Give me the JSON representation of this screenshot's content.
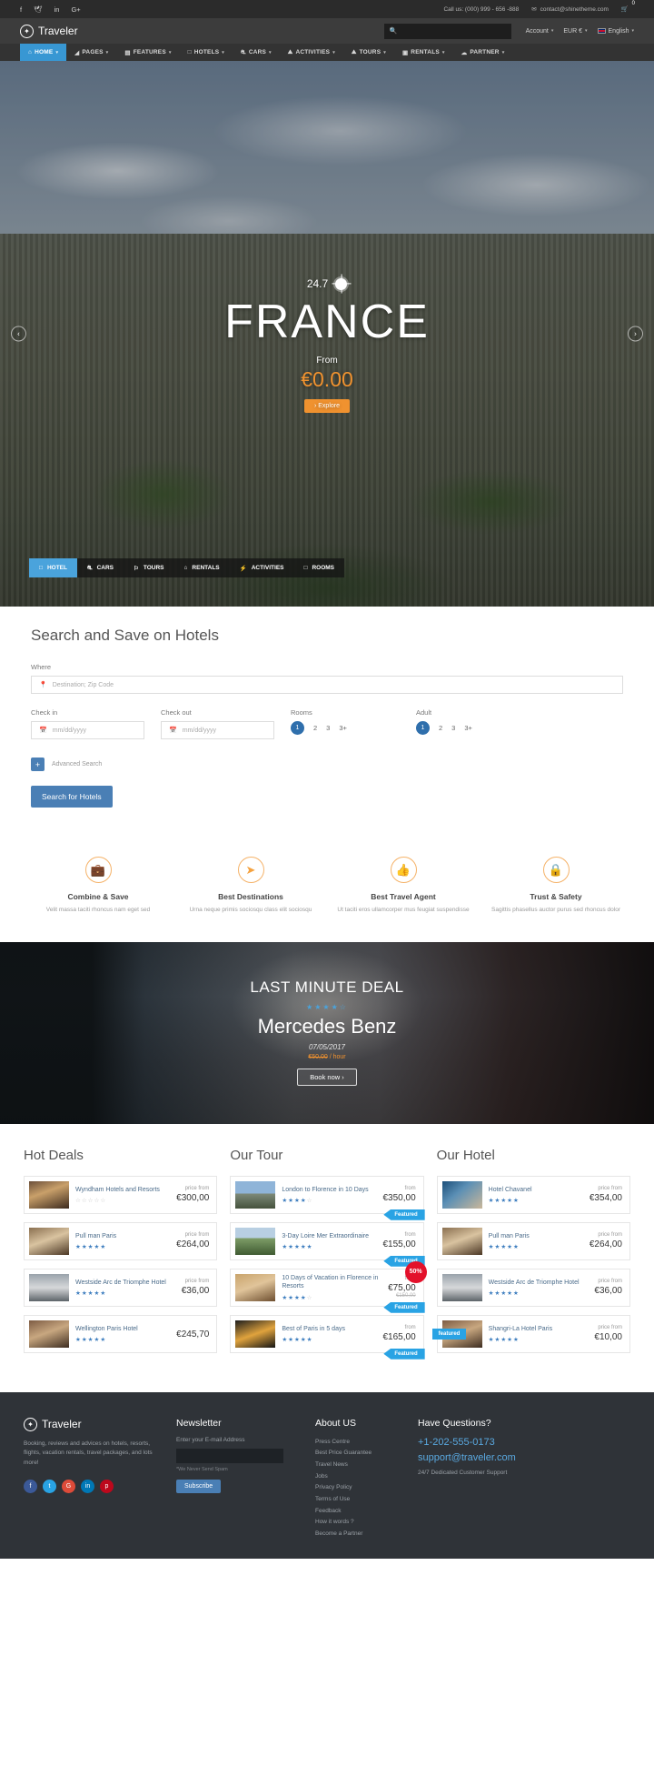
{
  "topbar": {
    "social": [
      {
        "name": "facebook-icon",
        "glyph": "f"
      },
      {
        "name": "twitter-icon",
        "glyph": "🕊"
      },
      {
        "name": "linkedin-icon",
        "glyph": "in"
      },
      {
        "name": "googleplus-icon",
        "glyph": "G+"
      }
    ],
    "phone": "Call us: (000) 999 - 656 -888",
    "email": "contact@shinetheme.com",
    "cart_count": "0"
  },
  "header": {
    "brand": "Traveler",
    "search_placeholder": "",
    "account_label": "Account",
    "currency_label": "EUR €",
    "language_label": "English"
  },
  "nav": {
    "items": [
      {
        "label": "HOME",
        "icon": "home-icon",
        "caret": true,
        "active": true
      },
      {
        "label": "PAGES",
        "icon": "pages-icon",
        "caret": true,
        "active": false
      },
      {
        "label": "FEATURES",
        "icon": "features-icon",
        "caret": true,
        "active": false
      },
      {
        "label": "HOTELS",
        "icon": "hotel-icon",
        "caret": true,
        "active": false
      },
      {
        "label": "CARS",
        "icon": "car-icon",
        "caret": true,
        "active": false
      },
      {
        "label": "ACTIVITIES",
        "icon": "activities-icon",
        "caret": true,
        "active": false
      },
      {
        "label": "TOURS",
        "icon": "tour-icon",
        "caret": true,
        "active": false
      },
      {
        "label": "RENTALS",
        "icon": "rental-icon",
        "caret": true,
        "active": false
      },
      {
        "label": "PARTNER",
        "icon": "partner-icon",
        "caret": true,
        "active": false
      }
    ]
  },
  "hero": {
    "temperature": "24.7",
    "title": "FRANCE",
    "from_label": "From",
    "price": "€0.00",
    "cta": "› Explore",
    "prev": "‹",
    "next": "›"
  },
  "search_tabs": [
    {
      "label": "HOTEL",
      "icon": "hotel-icon",
      "active": true
    },
    {
      "label": "CARS",
      "icon": "car-icon",
      "active": false
    },
    {
      "label": "TOURS",
      "icon": "flag-icon",
      "active": false
    },
    {
      "label": "RENTALS",
      "icon": "home-icon",
      "active": false
    },
    {
      "label": "ACTIVITIES",
      "icon": "bolt-icon",
      "active": false
    },
    {
      "label": "ROOMS",
      "icon": "room-icon",
      "active": false
    }
  ],
  "search": {
    "heading": "Search and Save on Hotels",
    "where_label": "Where",
    "where_placeholder": "Destination; Zip Code",
    "checkin_label": "Check in",
    "checkin_placeholder": "mm/dd/yyyy",
    "checkout_label": "Check out",
    "checkout_placeholder": "mm/dd/yyyy",
    "rooms_label": "Rooms",
    "rooms_options": [
      "1",
      "2",
      "3",
      "3+"
    ],
    "rooms_selected": "1",
    "adult_label": "Adult",
    "adult_options": [
      "1",
      "2",
      "3",
      "3+"
    ],
    "adult_selected": "1",
    "advanced_label": "Advanced Search",
    "submit_label": "Search for Hotels"
  },
  "features": [
    {
      "icon": "briefcase-icon",
      "glyph": "💼",
      "title": "Combine & Save",
      "desc": "Velit massa taciti rhoncus nam eget sed"
    },
    {
      "icon": "paper-plane-icon",
      "glyph": "➤",
      "title": "Best Destinations",
      "desc": "Urna neque primis sociosqu class elit sociosqu"
    },
    {
      "icon": "thumbs-up-icon",
      "glyph": "👍",
      "title": "Best Travel Agent",
      "desc": "Ut taciti eros ullamcorper mus feugiat suspendisse"
    },
    {
      "icon": "lock-icon",
      "glyph": "🔒",
      "title": "Trust & Safety",
      "desc": "Sagittis phasellus auctor purus sed rhoncus dolor"
    }
  ],
  "deal": {
    "kicker": "LAST MINUTE DEAL",
    "stars": 3.5,
    "name": "Mercedes Benz",
    "date": "07/05/2017",
    "old_price": "€50,00",
    "unit": "/ hour",
    "cta": "Book now  ›"
  },
  "listings": [
    {
      "title": "Hot Deals",
      "items": [
        {
          "thumb": "t-hotel1",
          "name": "Wyndham Hotels and Resorts",
          "stars": 0,
          "price_label": "price from",
          "price": "€300,00"
        },
        {
          "thumb": "t-hotel2",
          "name": "Pull man Paris",
          "stars": 5,
          "price_label": "price from",
          "price": "€264,00"
        },
        {
          "thumb": "t-hotel3",
          "name": "Westside Arc de Triomphe Hotel",
          "stars": 5,
          "price_label": "price from",
          "price": "€36,00"
        },
        {
          "thumb": "t-hotel4",
          "name": "Wellington Paris Hotel",
          "stars": 5,
          "price_label": "",
          "price": "€245,70"
        }
      ]
    },
    {
      "title": "Our Tour",
      "items": [
        {
          "thumb": "t-tour1",
          "name": "London to Florence in 10 Days",
          "stars": 4,
          "price_label": "from",
          "price": "€350,00",
          "ribbon": "Featured"
        },
        {
          "thumb": "t-tour2",
          "name": "3-Day Loire Mer Extraordinaire",
          "stars": 5,
          "price_label": "from",
          "price": "€155,00",
          "ribbon": "Featured"
        },
        {
          "thumb": "t-tour3",
          "name": "10 Days of Vacation in Florence in Resorts",
          "stars": 3.5,
          "price_label": "from",
          "price": "€75,00",
          "old_price": "€150,00",
          "ribbon": "Featured",
          "discount": "50%"
        },
        {
          "thumb": "t-tour4",
          "name": "Best of Paris in 5 days",
          "stars": 5,
          "price_label": "from",
          "price": "€165,00",
          "ribbon": "Featured"
        }
      ]
    },
    {
      "title": "Our Hotel",
      "items": [
        {
          "thumb": "t-room1",
          "name": "Hotel Chavanel",
          "stars": 5,
          "price_label": "price from",
          "price": "€354,00"
        },
        {
          "thumb": "t-hotel2",
          "name": "Pull man Paris",
          "stars": 5,
          "price_label": "price from",
          "price": "€264,00"
        },
        {
          "thumb": "t-hotel3",
          "name": "Westside Arc de Triomphe Hotel",
          "stars": 5,
          "price_label": "price from",
          "price": "€36,00"
        },
        {
          "thumb": "t-hotel4",
          "name": "Shangri-La Hotel Paris",
          "stars": 5,
          "price_label": "price from",
          "price": "€10,00",
          "ribbon_left": "featured"
        }
      ]
    }
  ],
  "footer": {
    "brand": "Traveler",
    "about": "Booking, reviews and advices on hotels, resorts, flights, vacation rentals, travel packages, and lots more!",
    "social": [
      {
        "name": "facebook-icon",
        "glyph": "f",
        "color": "#3b5998"
      },
      {
        "name": "twitter-icon",
        "glyph": "t",
        "color": "#29a3e4"
      },
      {
        "name": "googleplus-icon",
        "glyph": "G",
        "color": "#dd4b39"
      },
      {
        "name": "linkedin-icon",
        "glyph": "in",
        "color": "#0077b5"
      },
      {
        "name": "pinterest-icon",
        "glyph": "p",
        "color": "#bd081c"
      }
    ],
    "newsletter_title": "Newsletter",
    "newsletter_sub": "Enter your E-mail Address",
    "newsletter_note": "*We Never Send Spam",
    "newsletter_btn": "Subscribe",
    "links_title": "About US",
    "links": [
      "Press Centre",
      "Best Price Guarantee",
      "Travel News",
      "Jobs",
      "Privacy Policy",
      "Terms of Use",
      "Feedback",
      "How it words ?",
      "Become a Partner"
    ],
    "questions_title": "Have Questions?",
    "phone": "+1-202-555-0173",
    "email": "support@traveler.com",
    "dedicated": "24/7 Dedicated Customer Support"
  }
}
